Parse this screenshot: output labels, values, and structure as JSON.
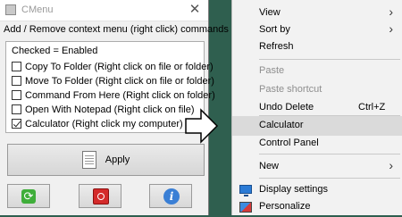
{
  "window": {
    "title": "CMenu",
    "close_label": "✕"
  },
  "instructions": "Add / Remove context menu (right click) commands",
  "options": {
    "legend": "Checked = Enabled",
    "items": [
      {
        "label": "Copy To Folder (Right click on file or folder)",
        "checked": false
      },
      {
        "label": "Move To Folder (Right click on file or folder)",
        "checked": false
      },
      {
        "label": "Command From Here (Right click on folder)",
        "checked": false
      },
      {
        "label": "Open With Notepad (Right click on file)",
        "checked": false
      },
      {
        "label": "Calculator (Right click my computer)",
        "checked": true
      }
    ]
  },
  "buttons": {
    "apply_label": "Apply",
    "apply_icon": "notepad-icon",
    "refresh_icon": "refresh-icon",
    "power_icon": "power-icon",
    "info_icon": "info-icon",
    "refresh_color": "#3fae3a",
    "power_color": "#d42b2b",
    "info_color": "#3a7fd5"
  },
  "context_menu": {
    "items": [
      {
        "label": "View",
        "submenu": true,
        "enabled": true
      },
      {
        "label": "Sort by",
        "submenu": true,
        "enabled": true
      },
      {
        "label": "Refresh",
        "enabled": true
      },
      {
        "label": "Paste",
        "enabled": false
      },
      {
        "label": "Paste shortcut",
        "enabled": false
      },
      {
        "label": "Undo Delete",
        "shortcut": "Ctrl+Z",
        "enabled": true
      },
      {
        "label": "Calculator",
        "enabled": true,
        "highlighted": true
      },
      {
        "label": "Control Panel",
        "enabled": true
      },
      {
        "label": "New",
        "submenu": true,
        "enabled": true
      },
      {
        "label": "Display settings",
        "icon": "display-icon",
        "enabled": true
      },
      {
        "label": "Personalize",
        "icon": "personalize-icon",
        "enabled": true
      }
    ],
    "submenu_arrow": "›"
  },
  "colors": {
    "desktop": "#2f5f4f",
    "menu_highlight": "#dadada",
    "disabled_text": "#8e8e8e"
  }
}
